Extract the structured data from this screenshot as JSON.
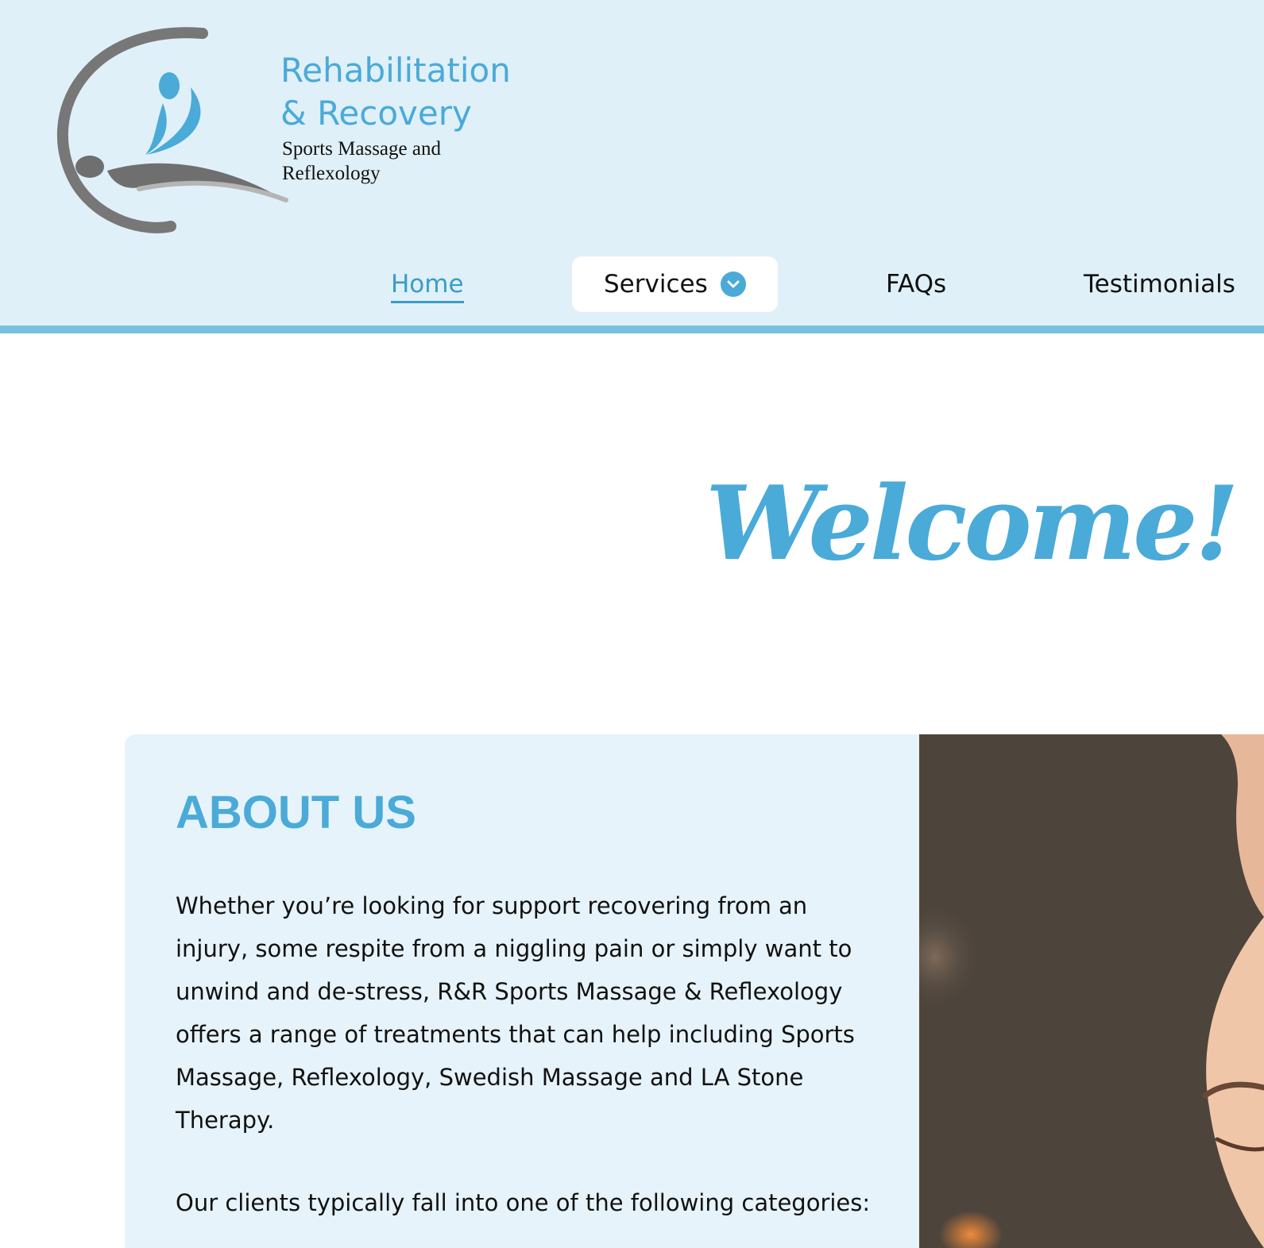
{
  "brand": {
    "title_line1": "Rehabilitation",
    "title_line2": "& Recovery",
    "subtitle_line1": "Sports Massage and",
    "subtitle_line2": "Reflexology",
    "accent_color": "#4aaad8",
    "logo_icon": "massage-figure-logo"
  },
  "nav": {
    "items": [
      {
        "label": "Home",
        "active": true
      },
      {
        "label": "Services",
        "has_dropdown": true,
        "dropdown_icon": "chevron-down-icon"
      },
      {
        "label": "FAQs"
      },
      {
        "label": "Testimonials"
      }
    ]
  },
  "hero": {
    "heading": "Welcome!"
  },
  "about": {
    "title": "ABOUT US",
    "paragraph1": "Whether you’re looking for support recovering from an injury, some respite from a niggling pain or simply want to unwind and de-stress, R&R Sports Massage & Reflexology offers a range of treatments that can help including Sports Massage, Reflexology, Swedish Massage and LA Stone Therapy.",
    "paragraph2": "Our clients typically fall into one of the following categories:",
    "image": "woman-relaxing-photo"
  }
}
